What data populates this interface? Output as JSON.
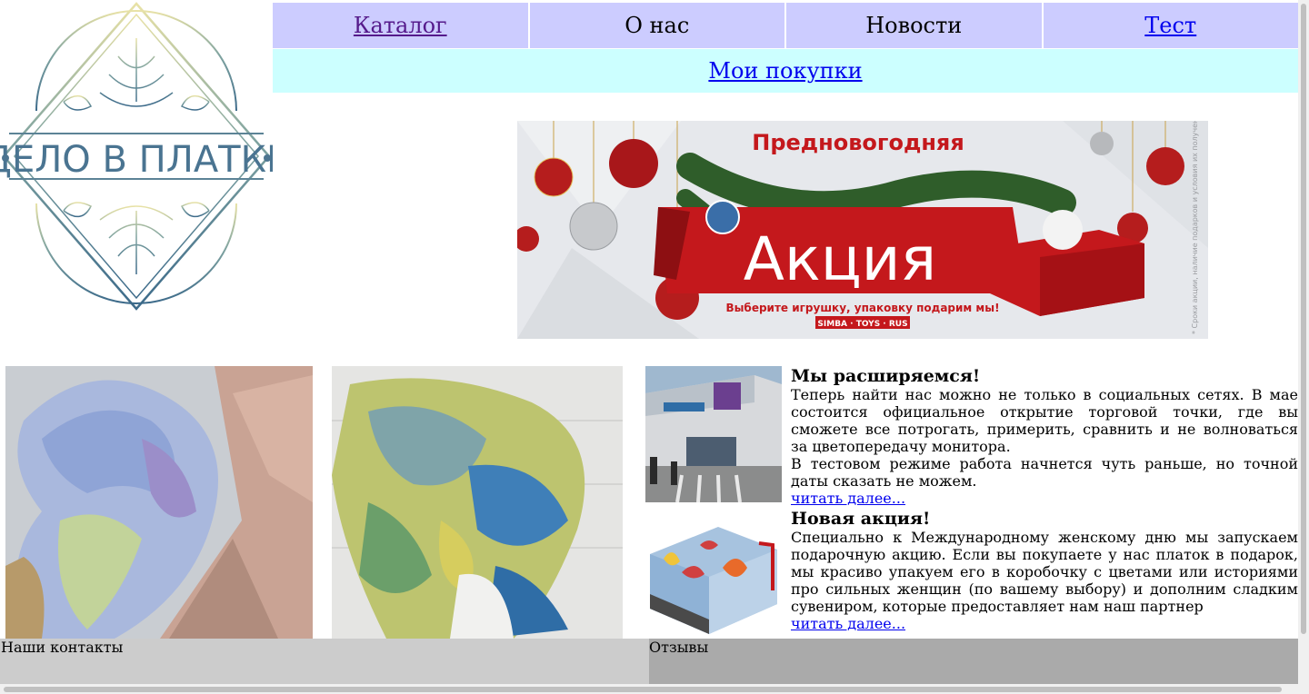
{
  "logo": {
    "text": "ДЕЛО В ПЛАТКЕ"
  },
  "nav": {
    "items": [
      {
        "label": "Каталог"
      },
      {
        "label": "О нас"
      },
      {
        "label": "Новости"
      },
      {
        "label": "Тест"
      }
    ],
    "purchases_label": "Мои покупки"
  },
  "banner": {
    "heading": "Предновогодняя",
    "title": "Акция",
    "subtitle": "Выберите игрушку, упаковку подарим мы!",
    "brand": "SIMBA · TOYS · RUS",
    "side_note": "* Сроки акции, наличие подарков и условия их получения уточняйте у продавцов в магазине"
  },
  "news": [
    {
      "title": "Мы расширяемся!",
      "paragraphs": [
        "Теперь найти нас можно не только в социальных сетях. В мае состоится официальное открытие торговой точки, где вы сможете все потрогать, примерить, сравнить и не волноваться за цветопередачу монитора.",
        "В тестовом режиме работа начнется чуть раньше, но точной даты сказать не можем."
      ],
      "more": "читать далее..."
    },
    {
      "title": "Новая акция!",
      "paragraphs": [
        "Специально к Международному женскому дню мы запускаем подарочную акцию. Если вы покупаете у нас платок в подарок, мы красиво упакуем его в коробочку с цветами или историями про сильных женщин (по вашему выбору) и дополним сладким сувениром, которые предоставляет нам наш партнер"
      ],
      "more": "читать далее..."
    }
  ],
  "footer": {
    "contacts": "Наши контакты",
    "reviews": "Отзывы"
  },
  "colors": {
    "nav_bg": "#ccccff",
    "purchases_bg": "#ccffff",
    "footer_left_bg": "#cccccc",
    "footer_right_bg": "#aaaaaa",
    "visited_link": "#551a8b",
    "link": "#0000ee"
  }
}
